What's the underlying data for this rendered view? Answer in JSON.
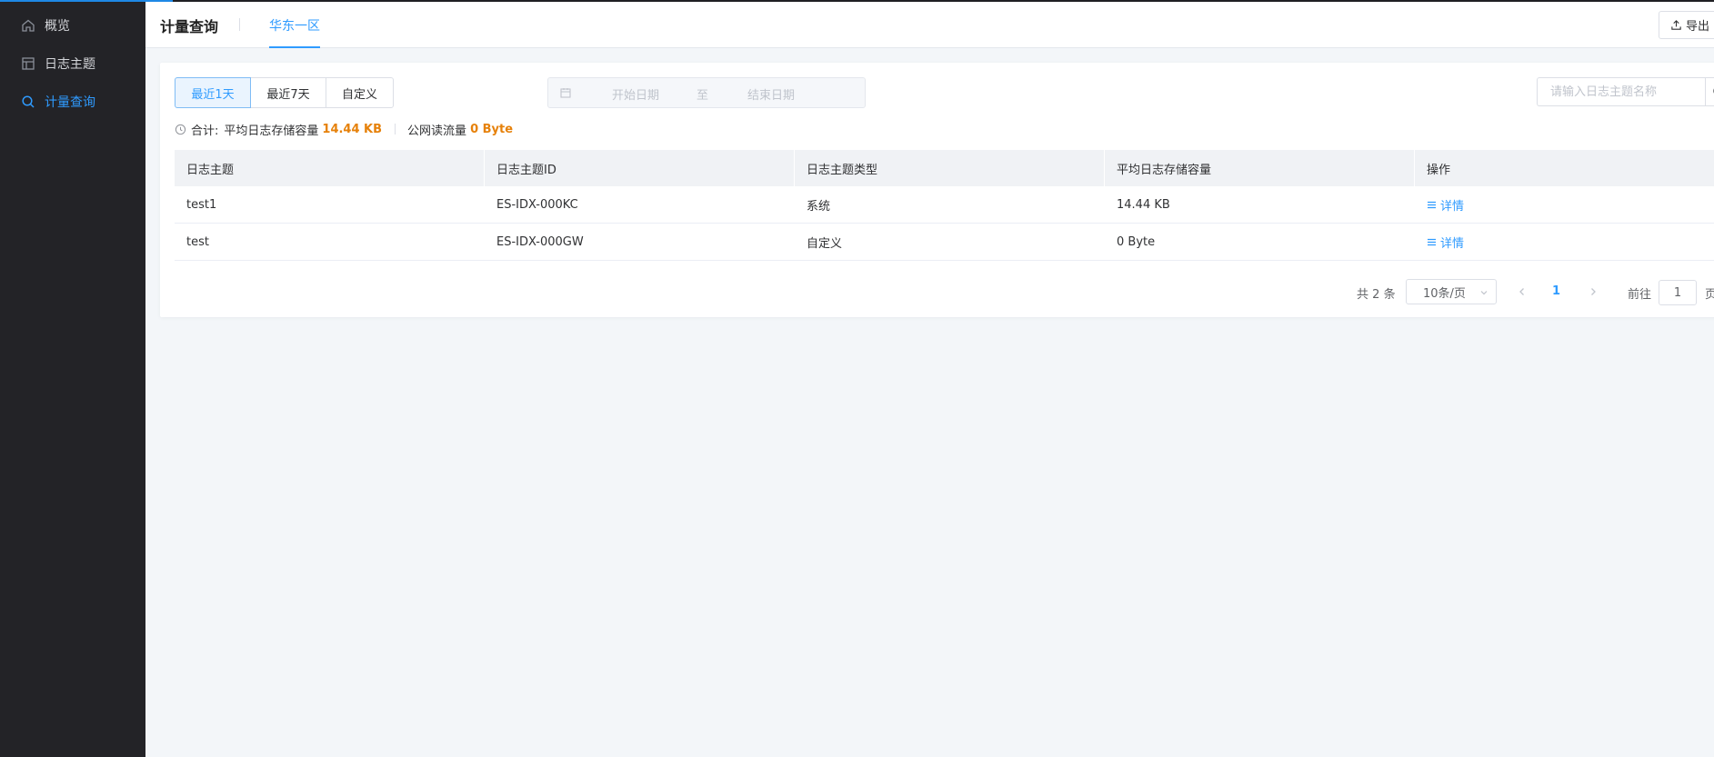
{
  "sidebar": {
    "items": [
      {
        "label": "概览",
        "icon": "home-icon"
      },
      {
        "label": "日志主题",
        "icon": "layout-icon"
      },
      {
        "label": "计量查询",
        "icon": "search-icon"
      }
    ]
  },
  "header": {
    "title": "计量查询",
    "region_tab": "华东一区",
    "export_label": "导出"
  },
  "filters": {
    "range_buttons": [
      "最近1天",
      "最近7天",
      "自定义"
    ],
    "start_placeholder": "开始日期",
    "separator": "至",
    "end_placeholder": "结束日期",
    "search_placeholder": "请输入日志主题名称"
  },
  "summary": {
    "total_label": "合计:",
    "storage_label": "平均日志存储容量",
    "storage_value": "14.44 KB",
    "traffic_label": "公网读流量",
    "traffic_value": "0 Byte"
  },
  "table": {
    "headers": [
      "日志主题",
      "日志主题ID",
      "日志主题类型",
      "平均日志存储容量",
      "操作"
    ],
    "rows": [
      {
        "name": "test1",
        "id": "ES-IDX-000KC",
        "type": "系统",
        "storage": "14.44 KB",
        "action": "详情"
      },
      {
        "name": "test",
        "id": "ES-IDX-000GW",
        "type": "自定义",
        "storage": "0 Byte",
        "action": "详情"
      }
    ]
  },
  "pagination": {
    "total_prefix": "共",
    "total_count": "2",
    "total_suffix": "条",
    "page_size": "10条/页",
    "current_page": "1",
    "goto_label": "前往",
    "goto_value": "1",
    "page_suffix": "页"
  },
  "colors": {
    "accent": "#2f9bff",
    "highlight": "#e6810a",
    "sidebar_bg": "#232327"
  }
}
